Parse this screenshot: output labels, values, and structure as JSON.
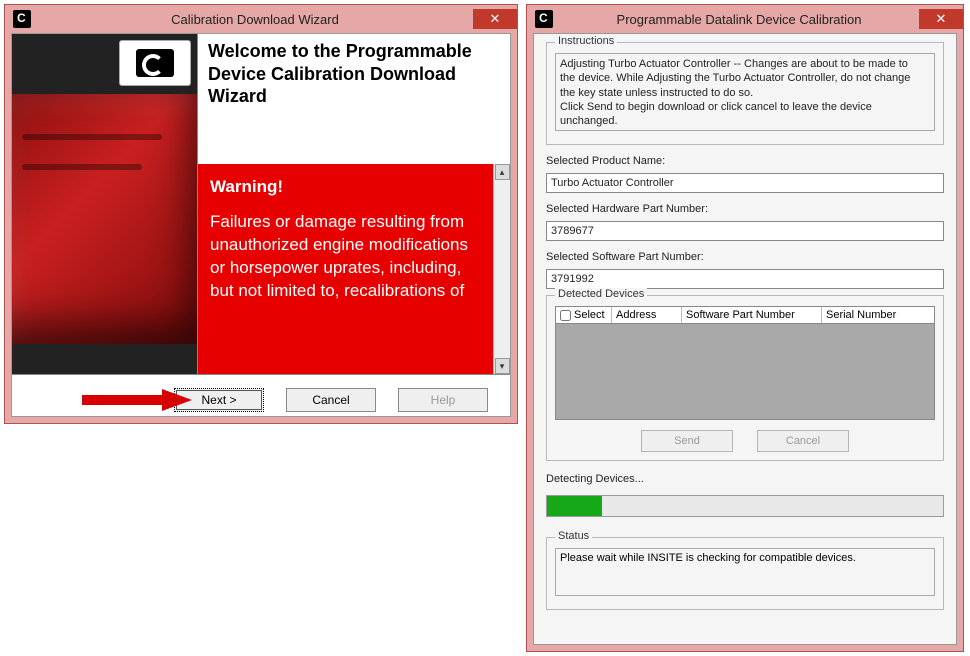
{
  "left": {
    "title": "Calibration Download Wizard",
    "heading": "Welcome to the Programmable Device Calibration Download Wizard",
    "warning_title": "Warning!",
    "warning_body": "Failures or damage resulting from unauthorized engine modifications or horsepower uprates, including, but not limited to, recalibrations of",
    "buttons": {
      "next": "Next >",
      "cancel": "Cancel",
      "help": "Help"
    }
  },
  "right": {
    "title": "Programmable Datalink Device Calibration",
    "instructions_label": "Instructions",
    "instructions_text": "Adjusting Turbo Actuator Controller -- Changes are about to be made to the device. While Adjusting the Turbo Actuator Controller, do not change the key state unless instructed to do so.\nClick Send to begin download or click cancel to leave the device unchanged.",
    "product_label": "Selected Product Name:",
    "product_value": "Turbo Actuator Controller",
    "hw_label": "Selected Hardware Part Number:",
    "hw_value": "3789677",
    "sw_label": "Selected Software Part Number:",
    "sw_value": "3791992",
    "devices_label": "Detected Devices",
    "col_select": "Select",
    "col_address": "Address",
    "col_swpn": "Software Part Number",
    "col_serial": "Serial Number",
    "send": "Send",
    "cancel": "Cancel",
    "detecting": "Detecting Devices...",
    "status_label": "Status",
    "status_text": "Please wait while INSITE is checking for compatible devices."
  }
}
